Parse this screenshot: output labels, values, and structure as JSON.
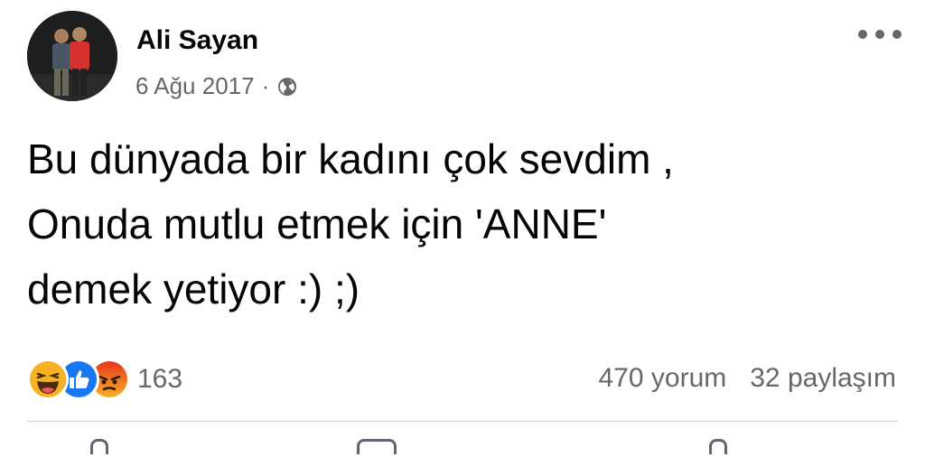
{
  "post": {
    "author": "Ali Sayan",
    "date": "6 Ağu 2017",
    "separator": "·",
    "privacy_icon": "globe-icon",
    "text": "Bu dünyada bir kadını çok sevdim ,\nOnuda mutlu etmek için 'ANNE'\ndemek yetiyor :) ;)"
  },
  "reactions": {
    "icons": [
      "haha-icon",
      "like-icon",
      "angry-icon"
    ],
    "count": "163"
  },
  "stats": {
    "comments": "470 yorum",
    "shares": "32 paylaşım"
  },
  "colors": {
    "like": "#1877f2",
    "haha": "#f7b125",
    "angry": "#e9710f",
    "secondary_text": "#65676b"
  }
}
